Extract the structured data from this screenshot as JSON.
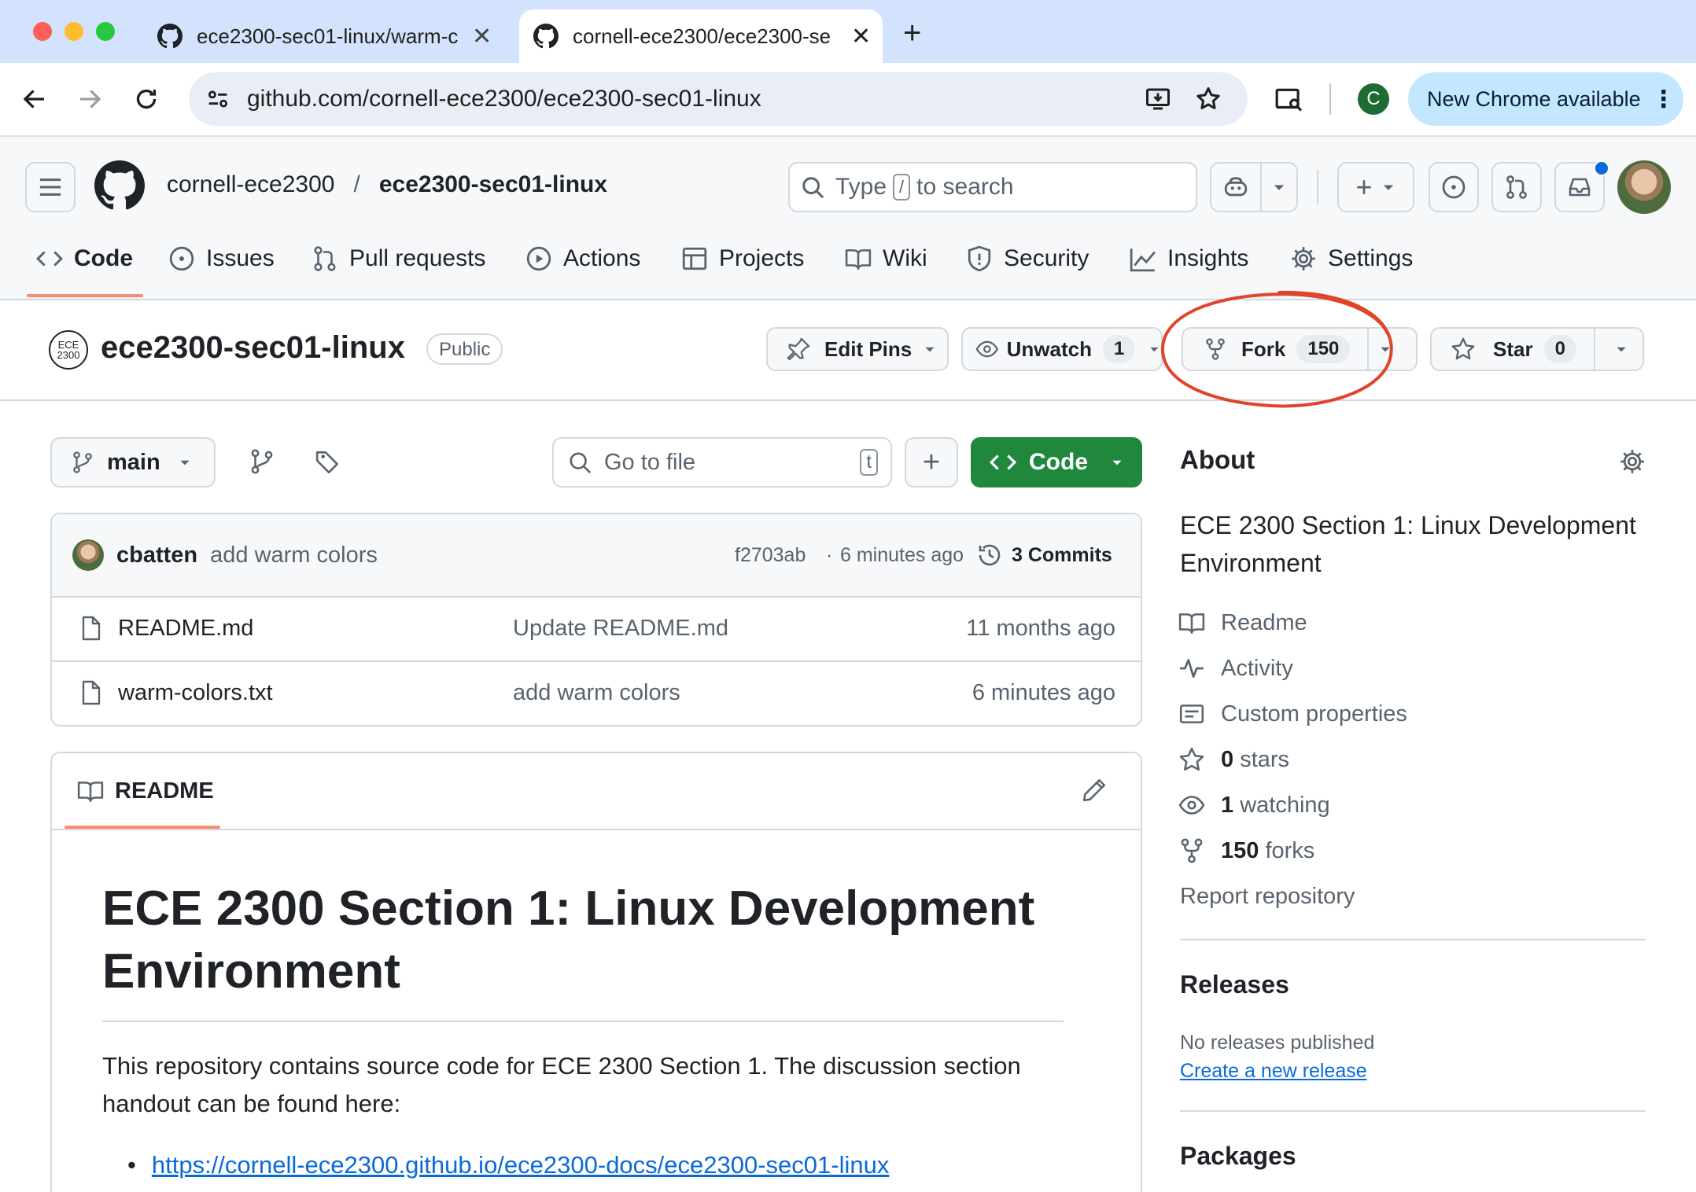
{
  "browser": {
    "tabs": [
      {
        "title": "ece2300-sec01-linux/warm-c"
      },
      {
        "title": "cornell-ece2300/ece2300-se"
      }
    ],
    "url": "github.com/cornell-ece2300/ece2300-sec01-linux",
    "new_chrome_label": "New Chrome available",
    "profile_initial": "C",
    "colors": {
      "tabstrip": "#d3e3fd",
      "omnibox": "#e9eef6",
      "new_chrome_bg": "#c2e7ff",
      "profile": "#1e6b34"
    }
  },
  "github": {
    "owner": "cornell-ece2300",
    "separator": "/",
    "repo": "ece2300-sec01-linux",
    "search": {
      "prefix": "Type",
      "key": "/",
      "suffix": "to search"
    },
    "nav": [
      {
        "label": "Code",
        "icon": "code-icon"
      },
      {
        "label": "Issues",
        "icon": "issue-icon"
      },
      {
        "label": "Pull requests",
        "icon": "pull-request-icon"
      },
      {
        "label": "Actions",
        "icon": "play-icon"
      },
      {
        "label": "Projects",
        "icon": "table-icon"
      },
      {
        "label": "Wiki",
        "icon": "book-icon"
      },
      {
        "label": "Security",
        "icon": "shield-icon"
      },
      {
        "label": "Insights",
        "icon": "graph-icon"
      },
      {
        "label": "Settings",
        "icon": "gear-icon"
      }
    ]
  },
  "repo_header": {
    "logo_text": [
      "ECE",
      "2300"
    ],
    "name": "ece2300-sec01-linux",
    "visibility": "Public",
    "edit_pins": "Edit Pins",
    "unwatch": "Unwatch",
    "watch_count": "1",
    "fork": "Fork",
    "fork_count": "150",
    "star": "Star",
    "star_count": "0"
  },
  "files": {
    "branch": "main",
    "go_to_file": "Go to file",
    "go_to_file_key": "t",
    "code_button": "Code",
    "latest_commit": {
      "author": "cbatten",
      "message": "add warm colors",
      "hash": "f2703ab",
      "dot": "·",
      "time": "6 minutes ago",
      "commits": "3 Commits"
    },
    "rows": [
      {
        "name": "README.md",
        "message": "Update README.md",
        "time": "11 months ago"
      },
      {
        "name": "warm-colors.txt",
        "message": "add warm colors",
        "time": "6 minutes ago"
      }
    ]
  },
  "readme": {
    "tab": "README",
    "heading": "ECE 2300 Section 1: Linux Development Environment",
    "body": "This repository contains source code for ECE 2300 Section 1. The discussion section handout can be found here:",
    "link": "https://cornell-ece2300.github.io/ece2300-docs/ece2300-sec01-linux"
  },
  "about": {
    "title": "About",
    "description": "ECE 2300 Section 1: Linux Development Environment",
    "items": [
      {
        "icon": "book-icon",
        "label": "Readme"
      },
      {
        "icon": "pulse-icon",
        "label": "Activity"
      },
      {
        "icon": "note-icon",
        "label": "Custom properties"
      }
    ],
    "stats": [
      {
        "icon": "star-icon",
        "count": "0",
        "label": "stars"
      },
      {
        "icon": "eye-icon",
        "count": "1",
        "label": "watching"
      },
      {
        "icon": "fork-icon",
        "count": "150",
        "label": "forks"
      }
    ],
    "report": "Report repository",
    "releases_title": "Releases",
    "releases_none": "No releases published",
    "releases_link": "Create a new release",
    "packages_title": "Packages"
  },
  "colors": {
    "green_button": "#1f883d",
    "annotation_circle": "#e0442b",
    "underline": "#fd8c73",
    "link": "#0969da"
  }
}
